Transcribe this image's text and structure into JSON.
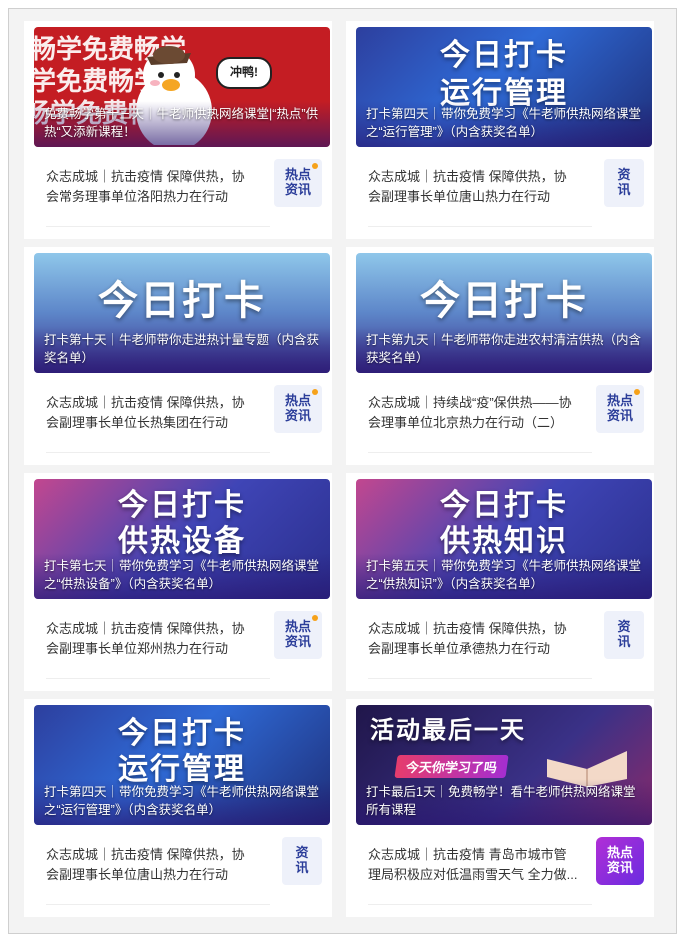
{
  "colors": {
    "frame_bg": "#f3f3f3",
    "accent_blue": "#2c3e9a",
    "badge_orange_dot": "#f6a21a",
    "red_banner": "#c41d23"
  },
  "cards": [
    {
      "banner_theme": "red",
      "banner_text": [
        "畅学免费畅学",
        "畅学免费畅学",
        "畅学免费畅学"
      ],
      "speech": "冲鸭!",
      "caption": "免费畅学第十三天｜牛老师供热网络课堂|“热点”供热“又添新课程！",
      "item_text": "众志成城｜抗击疫情 保障供热，协会常务理事单位洛阳热力在行动",
      "badge": [
        "热点",
        "资讯"
      ]
    },
    {
      "banner_theme": "blue",
      "banner_big": [
        "今日打卡",
        "运行管理"
      ],
      "caption": "打卡第四天｜带你免费学习《牛老师供热网络课堂之“运行管理”》（内含获奖名单）",
      "item_text": "众志成城｜抗击疫情 保障供热，协会副理事长单位唐山热力在行动",
      "badge": [
        "资",
        "讯"
      ]
    },
    {
      "banner_theme": "tech",
      "banner_big": [
        "今日打卡"
      ],
      "caption": "打卡第十天｜牛老师带你走进热计量专题（内含获奖名单）",
      "item_text": "众志成城｜抗击疫情 保障供热，协会副理事长单位长热集团在行动",
      "badge": [
        "热点",
        "资讯"
      ]
    },
    {
      "banner_theme": "tech",
      "banner_big": [
        "今日打卡"
      ],
      "caption": "打卡第九天｜牛老师带你走进农村清洁供热（内含获奖名单）",
      "item_text": "众志成城｜持续战“疫”保供热——协会理事单位北京热力在行动（二）",
      "badge": [
        "热点",
        "资讯"
      ]
    },
    {
      "banner_theme": "purple",
      "banner_big": [
        "今日打卡",
        "供热设备"
      ],
      "caption": "打卡第七天｜带你免费学习《牛老师供热网络课堂之“供热设备”》（内含获奖名单）",
      "item_text": "众志成城｜抗击疫情 保障供热，协会副理事长单位郑州热力在行动",
      "badge": [
        "热点",
        "资讯"
      ]
    },
    {
      "banner_theme": "purple",
      "banner_big": [
        "今日打卡",
        "供热知识"
      ],
      "caption": "打卡第五天｜带你免费学习《牛老师供热网络课堂之“供热知识”》（内含获奖名单）",
      "item_text": "众志成城｜抗击疫情 保障供热，协会副理事长单位承德热力在行动",
      "badge": [
        "资",
        "讯"
      ]
    },
    {
      "banner_theme": "blue",
      "banner_big": [
        "今日打卡",
        "运行管理"
      ],
      "caption": "打卡第四天｜带你免费学习《牛老师供热网络课堂之“运行管理”》（内含获奖名单）",
      "item_text": "众志成城｜抗击疫情 保障供热，协会副理事长单位唐山热力在行动",
      "badge": [
        "资",
        "讯"
      ]
    },
    {
      "banner_theme": "dark",
      "banner_big": [
        "活动最后一天"
      ],
      "banner_sub": "今天你学习了吗",
      "caption": "打卡最后1天｜免费畅学！看牛老师供热网络课堂所有课程",
      "item_text": "众志成城｜抗击疫情 青岛市城市管理局积极应对低温雨雪天气 全力做...",
      "badge": [
        "热点",
        "资讯"
      ]
    }
  ]
}
